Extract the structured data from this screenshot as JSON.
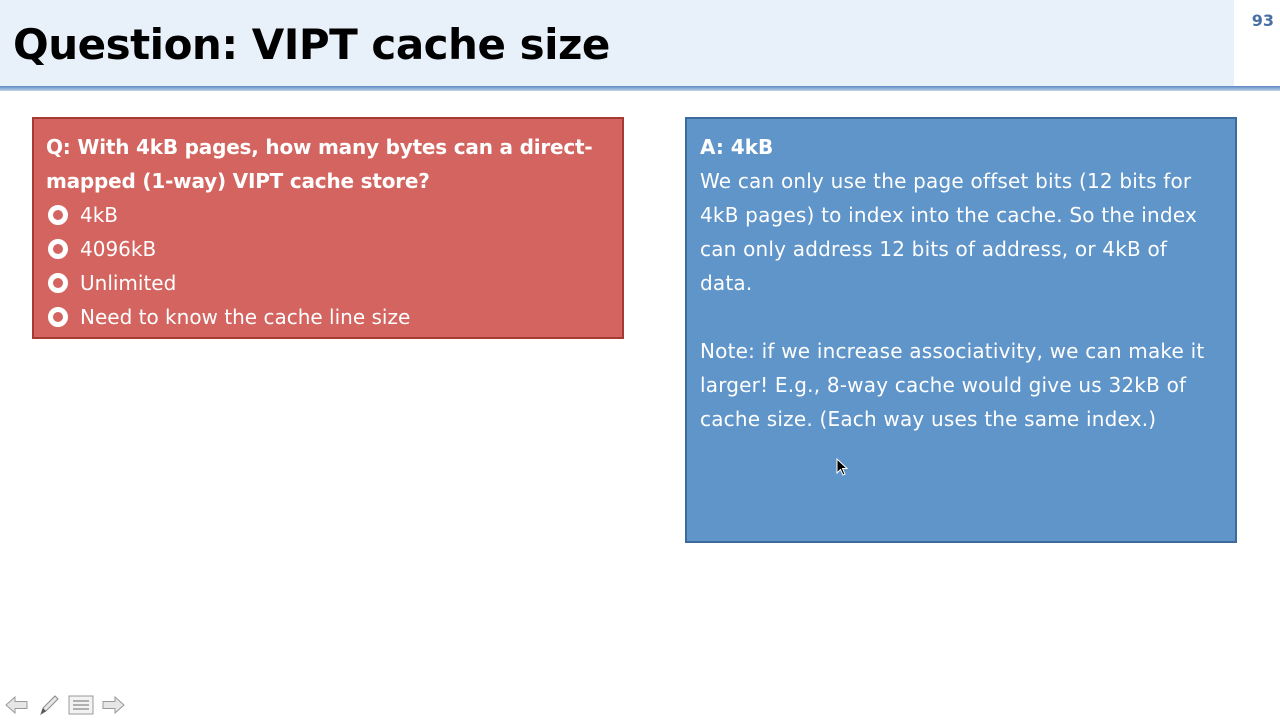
{
  "slide": {
    "title": "Question: VIPT cache size",
    "page_number": "93"
  },
  "question_box": {
    "question": "Q: With 4kB pages, how many bytes can a direct-mapped (1-way) VIPT cache store?",
    "options": [
      "4kB",
      "4096kB",
      "Unlimited",
      "Need to know the cache line size"
    ]
  },
  "answer_box": {
    "answer": "A: 4kB",
    "explanation": "We can only use the page offset bits (12 bits for 4kB pages) to index into the cache. So the index can only address 12 bits of address, or 4kB of data.",
    "note": "Note: if we increase associativity, we can make it larger! E.g., 8-way cache would give us 32kB of cache size. (Each way uses the same index.)"
  },
  "colors": {
    "question_bg": "#d3645f",
    "answer_bg": "#6095ca",
    "title_bg": "#e8f0f9",
    "accent": "#4a6fa5"
  },
  "nav_icons": [
    "arrow-left-icon",
    "pen-icon",
    "menu-icon",
    "arrow-right-icon"
  ]
}
